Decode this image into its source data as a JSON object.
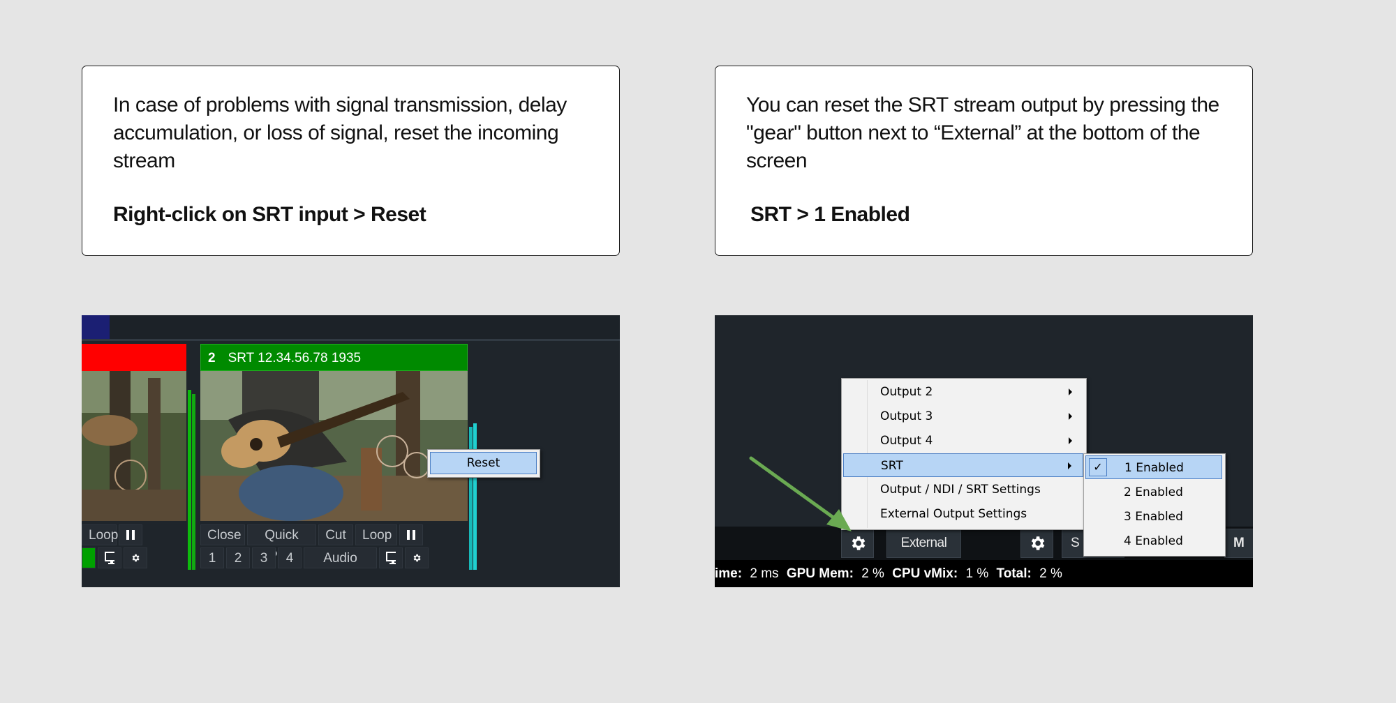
{
  "left_card": {
    "description": "In case of problems with signal transmission, delay accumulation, or loss of signal, reset the incoming stream",
    "instruction": "Right-click on SRT input > Reset"
  },
  "right_card": {
    "description": "You can reset the SRT stream output by pressing the \"gear\" button next to “External” at the bottom of the screen",
    "instruction": "SRT  > 1 Enabled"
  },
  "left_shot": {
    "input2": {
      "number": "2",
      "title": "SRT 12.34.56.78 1935"
    },
    "input1_buttons": {
      "loop": "Loop"
    },
    "input2_buttons": {
      "close": "Close",
      "quick_play": "Quick Play",
      "cut": "Cut",
      "loop": "Loop",
      "layers": [
        "1",
        "2",
        "3",
        "4"
      ],
      "audio": "Audio"
    },
    "context_menu": {
      "reset": "Reset"
    },
    "icons": [
      "pause-icon",
      "monitor-icon",
      "gear-icon"
    ],
    "colors": {
      "input1_header": "#ff0000",
      "input2_header": "#008a00",
      "menu_highlight": "#b7d5f5"
    }
  },
  "right_shot": {
    "menu": [
      {
        "label": "Output 2",
        "submenu": true
      },
      {
        "label": "Output 3",
        "submenu": true
      },
      {
        "label": "Output 4",
        "submenu": true
      },
      {
        "label": "SRT",
        "submenu": true,
        "selected": true
      },
      {
        "label": "Output / NDI / SRT Settings",
        "submenu": false
      },
      {
        "label": "External Output Settings",
        "submenu": false
      }
    ],
    "submenu": [
      {
        "label": "1 Enabled",
        "checked": true
      },
      {
        "label": "2 Enabled",
        "checked": false
      },
      {
        "label": "3 Enabled",
        "checked": false
      },
      {
        "label": "4 Enabled",
        "checked": false
      }
    ],
    "external_label": "External",
    "cut_button_partial": "S",
    "m_button_partial": "M",
    "status": {
      "time_label": "ime:",
      "time_value": "2 ms",
      "gpu_label": "GPU Mem:",
      "gpu_value": "2 %",
      "cpu_label": "CPU vMix:",
      "cpu_value": "1 %",
      "total_label": "Total:",
      "total_value": "2 %"
    },
    "colors": {
      "arrow": "#6aaa52"
    }
  }
}
